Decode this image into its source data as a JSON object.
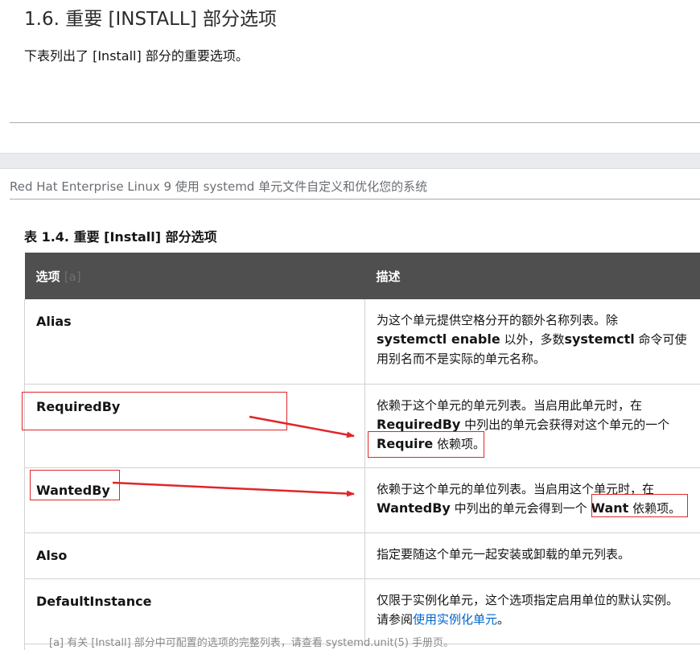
{
  "section": {
    "title": "1.6. 重要 [INSTALL] 部分选项",
    "intro": "下表列出了 [Install] 部分的重要选项。"
  },
  "running_header": "Red Hat Enterprise Linux 9 使用 systemd 单元文件自定义和优化您的系统",
  "table": {
    "caption": "表 1.4. 重要 [Install] 部分选项",
    "header_option": "选项 ",
    "header_footnote": "[a]",
    "header_description": "描述",
    "rows": [
      {
        "option": "Alias",
        "desc": [
          "为这个单元提供空格分开的额外名称列表。除 ",
          "systemctl enable",
          " 以外，多数",
          "systemctl",
          " 命令可使用别名而不是实际的单元名称。"
        ]
      },
      {
        "option": "RequiredBy",
        "desc": [
          "依赖于这个单元的单元列表。当启用此单元时，在 ",
          "RequiredBy",
          " 中列出的单元会获得对这个单元的一个 ",
          "Require",
          " 依赖项。"
        ]
      },
      {
        "option": "WantedBy",
        "desc": [
          "依赖于这个单元的单位列表。当启用这个单元时，在 ",
          "WantedBy",
          " 中列出的单元会得到一个 ",
          "Want",
          " 依赖项。"
        ]
      },
      {
        "option": "Also",
        "desc": [
          "指定要随这个单元一起安装或卸载的单元列表。"
        ]
      },
      {
        "option": "DefaultInstance",
        "desc": [
          "仅限于实例化单元，这个选项指定启用单位的默认实例。请参阅",
          "使用实例化单元",
          "。"
        ]
      }
    ]
  },
  "footnote": "[a] 有关 [Install] 部分中可配置的选项的完整列表，请查看 systemd.unit(5) 手册页。"
}
